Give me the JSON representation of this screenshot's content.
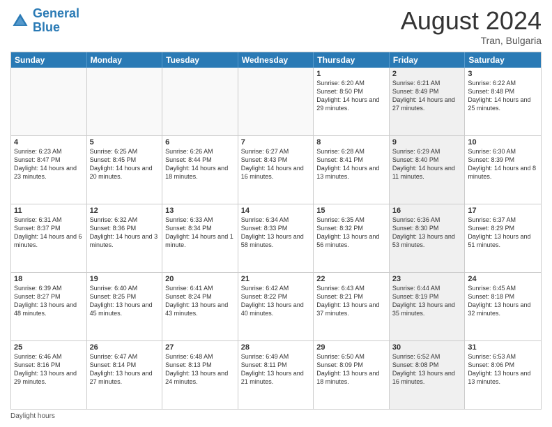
{
  "header": {
    "logo_general": "General",
    "logo_blue": "Blue",
    "month_year": "August 2024",
    "location": "Tran, Bulgaria"
  },
  "days_of_week": [
    "Sunday",
    "Monday",
    "Tuesday",
    "Wednesday",
    "Thursday",
    "Friday",
    "Saturday"
  ],
  "weeks": [
    [
      {
        "day": "",
        "info": "",
        "shaded": false
      },
      {
        "day": "",
        "info": "",
        "shaded": false
      },
      {
        "day": "",
        "info": "",
        "shaded": false
      },
      {
        "day": "",
        "info": "",
        "shaded": false
      },
      {
        "day": "1",
        "info": "Sunrise: 6:20 AM\nSunset: 8:50 PM\nDaylight: 14 hours\nand 29 minutes.",
        "shaded": false
      },
      {
        "day": "2",
        "info": "Sunrise: 6:21 AM\nSunset: 8:49 PM\nDaylight: 14 hours\nand 27 minutes.",
        "shaded": true
      },
      {
        "day": "3",
        "info": "Sunrise: 6:22 AM\nSunset: 8:48 PM\nDaylight: 14 hours\nand 25 minutes.",
        "shaded": false
      }
    ],
    [
      {
        "day": "4",
        "info": "Sunrise: 6:23 AM\nSunset: 8:47 PM\nDaylight: 14 hours\nand 23 minutes.",
        "shaded": false
      },
      {
        "day": "5",
        "info": "Sunrise: 6:25 AM\nSunset: 8:45 PM\nDaylight: 14 hours\nand 20 minutes.",
        "shaded": false
      },
      {
        "day": "6",
        "info": "Sunrise: 6:26 AM\nSunset: 8:44 PM\nDaylight: 14 hours\nand 18 minutes.",
        "shaded": false
      },
      {
        "day": "7",
        "info": "Sunrise: 6:27 AM\nSunset: 8:43 PM\nDaylight: 14 hours\nand 16 minutes.",
        "shaded": false
      },
      {
        "day": "8",
        "info": "Sunrise: 6:28 AM\nSunset: 8:41 PM\nDaylight: 14 hours\nand 13 minutes.",
        "shaded": false
      },
      {
        "day": "9",
        "info": "Sunrise: 6:29 AM\nSunset: 8:40 PM\nDaylight: 14 hours\nand 11 minutes.",
        "shaded": true
      },
      {
        "day": "10",
        "info": "Sunrise: 6:30 AM\nSunset: 8:39 PM\nDaylight: 14 hours\nand 8 minutes.",
        "shaded": false
      }
    ],
    [
      {
        "day": "11",
        "info": "Sunrise: 6:31 AM\nSunset: 8:37 PM\nDaylight: 14 hours\nand 6 minutes.",
        "shaded": false
      },
      {
        "day": "12",
        "info": "Sunrise: 6:32 AM\nSunset: 8:36 PM\nDaylight: 14 hours\nand 3 minutes.",
        "shaded": false
      },
      {
        "day": "13",
        "info": "Sunrise: 6:33 AM\nSunset: 8:34 PM\nDaylight: 14 hours\nand 1 minute.",
        "shaded": false
      },
      {
        "day": "14",
        "info": "Sunrise: 6:34 AM\nSunset: 8:33 PM\nDaylight: 13 hours\nand 58 minutes.",
        "shaded": false
      },
      {
        "day": "15",
        "info": "Sunrise: 6:35 AM\nSunset: 8:32 PM\nDaylight: 13 hours\nand 56 minutes.",
        "shaded": false
      },
      {
        "day": "16",
        "info": "Sunrise: 6:36 AM\nSunset: 8:30 PM\nDaylight: 13 hours\nand 53 minutes.",
        "shaded": true
      },
      {
        "day": "17",
        "info": "Sunrise: 6:37 AM\nSunset: 8:29 PM\nDaylight: 13 hours\nand 51 minutes.",
        "shaded": false
      }
    ],
    [
      {
        "day": "18",
        "info": "Sunrise: 6:39 AM\nSunset: 8:27 PM\nDaylight: 13 hours\nand 48 minutes.",
        "shaded": false
      },
      {
        "day": "19",
        "info": "Sunrise: 6:40 AM\nSunset: 8:25 PM\nDaylight: 13 hours\nand 45 minutes.",
        "shaded": false
      },
      {
        "day": "20",
        "info": "Sunrise: 6:41 AM\nSunset: 8:24 PM\nDaylight: 13 hours\nand 43 minutes.",
        "shaded": false
      },
      {
        "day": "21",
        "info": "Sunrise: 6:42 AM\nSunset: 8:22 PM\nDaylight: 13 hours\nand 40 minutes.",
        "shaded": false
      },
      {
        "day": "22",
        "info": "Sunrise: 6:43 AM\nSunset: 8:21 PM\nDaylight: 13 hours\nand 37 minutes.",
        "shaded": false
      },
      {
        "day": "23",
        "info": "Sunrise: 6:44 AM\nSunset: 8:19 PM\nDaylight: 13 hours\nand 35 minutes.",
        "shaded": true
      },
      {
        "day": "24",
        "info": "Sunrise: 6:45 AM\nSunset: 8:18 PM\nDaylight: 13 hours\nand 32 minutes.",
        "shaded": false
      }
    ],
    [
      {
        "day": "25",
        "info": "Sunrise: 6:46 AM\nSunset: 8:16 PM\nDaylight: 13 hours\nand 29 minutes.",
        "shaded": false
      },
      {
        "day": "26",
        "info": "Sunrise: 6:47 AM\nSunset: 8:14 PM\nDaylight: 13 hours\nand 27 minutes.",
        "shaded": false
      },
      {
        "day": "27",
        "info": "Sunrise: 6:48 AM\nSunset: 8:13 PM\nDaylight: 13 hours\nand 24 minutes.",
        "shaded": false
      },
      {
        "day": "28",
        "info": "Sunrise: 6:49 AM\nSunset: 8:11 PM\nDaylight: 13 hours\nand 21 minutes.",
        "shaded": false
      },
      {
        "day": "29",
        "info": "Sunrise: 6:50 AM\nSunset: 8:09 PM\nDaylight: 13 hours\nand 18 minutes.",
        "shaded": false
      },
      {
        "day": "30",
        "info": "Sunrise: 6:52 AM\nSunset: 8:08 PM\nDaylight: 13 hours\nand 16 minutes.",
        "shaded": true
      },
      {
        "day": "31",
        "info": "Sunrise: 6:53 AM\nSunset: 8:06 PM\nDaylight: 13 hours\nand 13 minutes.",
        "shaded": false
      }
    ]
  ],
  "footer": {
    "note": "Daylight hours"
  }
}
